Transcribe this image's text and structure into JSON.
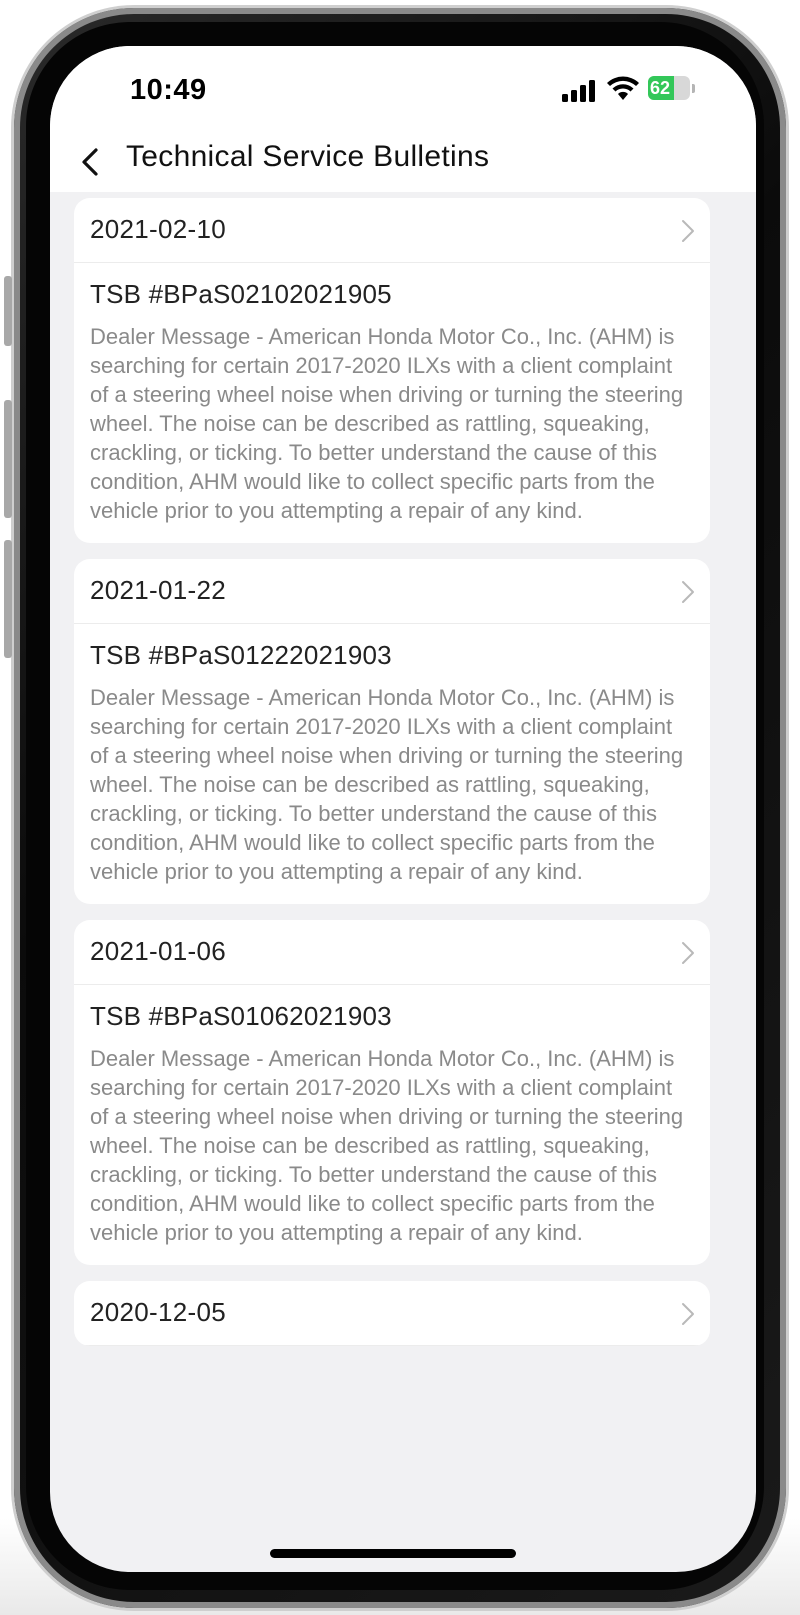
{
  "status_bar": {
    "time": "10:49",
    "battery_level": "62",
    "battery_fraction": 0.62
  },
  "nav": {
    "title": "Technical Service Bulletins",
    "back_icon": "chevron-left-icon"
  },
  "bulletins": [
    {
      "date": "2021-02-10",
      "tsb": "TSB #BPaS02102021905",
      "message": "Dealer Message - American Honda Motor Co., Inc. (AHM) is searching for certain 2017-2020 ILXs with a client complaint of a steering wheel noise when driving or turning the steering wheel. The noise can be described as rattling, squeaking, crackling, or ticking. To better understand the cause of this condition, AHM would like to collect specific parts from the vehicle prior to you attempting a repair of any kind."
    },
    {
      "date": "2021-01-22",
      "tsb": "TSB #BPaS01222021903",
      "message": "Dealer Message - American Honda Motor Co., Inc. (AHM) is searching for certain 2017-2020 ILXs with a client complaint of a steering wheel noise when driving or turning the steering wheel. The noise can be described as rattling, squeaking, crackling, or ticking. To better understand the cause of this condition, AHM would like to collect specific parts from the vehicle prior to you attempting a repair of any kind."
    },
    {
      "date": "2021-01-06",
      "tsb": "TSB #BPaS01062021903",
      "message": "Dealer Message - American Honda Motor Co., Inc. (AHM) is searching for certain 2017-2020 ILXs with a client complaint of a steering wheel noise when driving or turning the steering wheel. The noise can be described as rattling, squeaking, crackling, or ticking. To better understand the cause of this condition, AHM would like to collect specific parts from the vehicle prior to you attempting a repair of any kind."
    },
    {
      "date": "2020-12-05"
    }
  ],
  "colors": {
    "background": "#f1f1f3",
    "card": "#ffffff",
    "message_text": "#8a8a8a",
    "battery_green": "#33c759"
  }
}
